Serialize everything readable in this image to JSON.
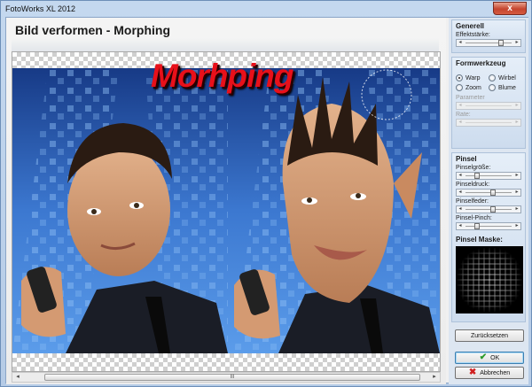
{
  "window": {
    "title": "FotoWorks XL 2012",
    "close_glyph": "x"
  },
  "page": {
    "heading": "Bild verformen - Morphing"
  },
  "canvas": {
    "overlay_text": "Morhping"
  },
  "scroll": {
    "left_glyph": "◂",
    "right_glyph": "▸",
    "grip": "III"
  },
  "generell": {
    "title": "Generell",
    "effect_label": "Effektstärke:",
    "effect_value": 0.8
  },
  "formwerkzeug": {
    "title": "Formwerkzeug",
    "options": [
      "Warp",
      "Wirbel",
      "Zoom",
      "Blume"
    ],
    "selected": "Warp",
    "parameter_label": "Parameter",
    "rate_label": "Rate:"
  },
  "pinsel": {
    "title": "Pinsel",
    "size_label": "Pinselgröße:",
    "size_value": 0.22,
    "pressure_label": "Pinseldruck:",
    "pressure_value": 0.6,
    "feather_label": "Pinselfeder:",
    "feather_value": 0.6,
    "pinch_label": "Pinsel-Pinch:",
    "pinch_value": 0.22,
    "mask_title": "Pinsel Maske:"
  },
  "buttons": {
    "reset": "Zurücksetzen",
    "ok": "OK",
    "cancel": "Abbrechen"
  },
  "colors": {
    "accent_red": "#e8101a",
    "ok_green": "#2a9a2a",
    "cancel_red": "#d02020"
  }
}
